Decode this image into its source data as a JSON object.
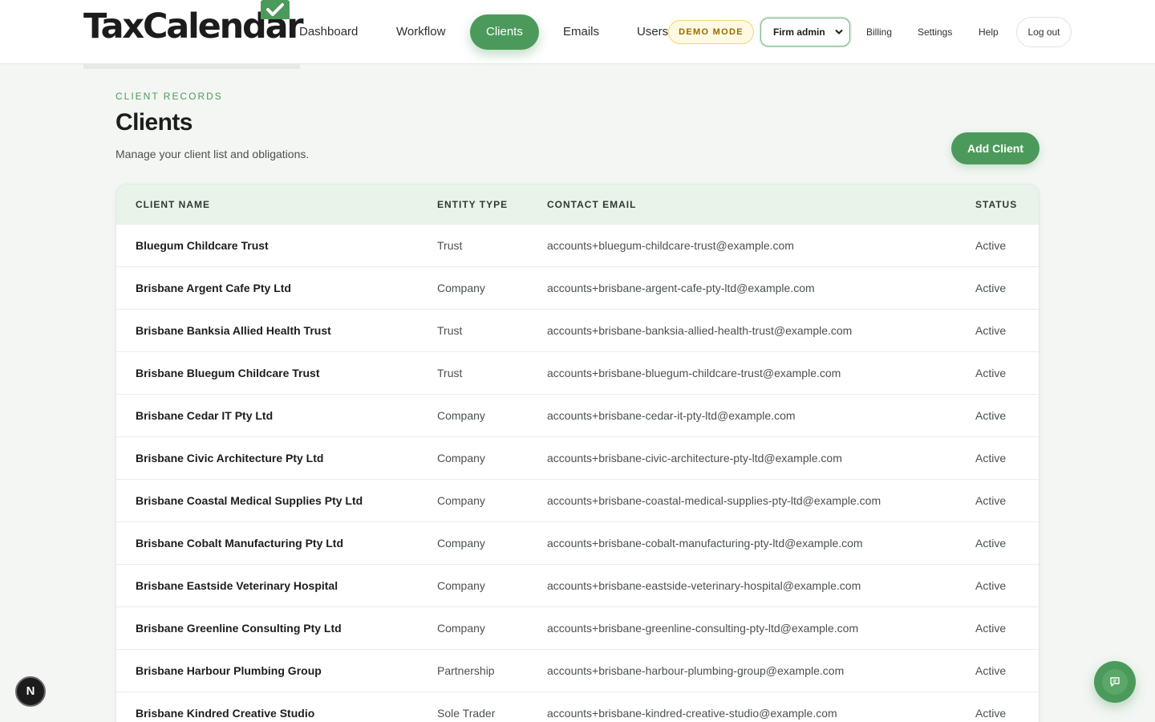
{
  "header": {
    "logo_text": "TaxCalendar",
    "nav": [
      "Dashboard",
      "Workflow",
      "Clients",
      "Emails",
      "Users"
    ],
    "active_nav": "Clients",
    "demo_badge": "DEMO MODE",
    "role": "Firm admin",
    "links": [
      "Billing",
      "Settings",
      "Help"
    ],
    "logout": "Log out",
    "accent_color": "#4c9a5b"
  },
  "page": {
    "eyebrow": "CLIENT RECORDS",
    "title": "Clients",
    "subtitle": "Manage your client list and obligations.",
    "add_button": "Add Client"
  },
  "table": {
    "columns": [
      "CLIENT NAME",
      "ENTITY TYPE",
      "CONTACT EMAIL",
      "STATUS"
    ],
    "rows": [
      {
        "name": "Bluegum Childcare Trust",
        "entity": "Trust",
        "email": "accounts+bluegum-childcare-trust@example.com",
        "status": "Active"
      },
      {
        "name": "Brisbane Argent Cafe Pty Ltd",
        "entity": "Company",
        "email": "accounts+brisbane-argent-cafe-pty-ltd@example.com",
        "status": "Active"
      },
      {
        "name": "Brisbane Banksia Allied Health Trust",
        "entity": "Trust",
        "email": "accounts+brisbane-banksia-allied-health-trust@example.com",
        "status": "Active"
      },
      {
        "name": "Brisbane Bluegum Childcare Trust",
        "entity": "Trust",
        "email": "accounts+brisbane-bluegum-childcare-trust@example.com",
        "status": "Active"
      },
      {
        "name": "Brisbane Cedar IT Pty Ltd",
        "entity": "Company",
        "email": "accounts+brisbane-cedar-it-pty-ltd@example.com",
        "status": "Active"
      },
      {
        "name": "Brisbane Civic Architecture Pty Ltd",
        "entity": "Company",
        "email": "accounts+brisbane-civic-architecture-pty-ltd@example.com",
        "status": "Active"
      },
      {
        "name": "Brisbane Coastal Medical Supplies Pty Ltd",
        "entity": "Company",
        "email": "accounts+brisbane-coastal-medical-supplies-pty-ltd@example.com",
        "status": "Active"
      },
      {
        "name": "Brisbane Cobalt Manufacturing Pty Ltd",
        "entity": "Company",
        "email": "accounts+brisbane-cobalt-manufacturing-pty-ltd@example.com",
        "status": "Active"
      },
      {
        "name": "Brisbane Eastside Veterinary Hospital",
        "entity": "Company",
        "email": "accounts+brisbane-eastside-veterinary-hospital@example.com",
        "status": "Active"
      },
      {
        "name": "Brisbane Greenline Consulting Pty Ltd",
        "entity": "Company",
        "email": "accounts+brisbane-greenline-consulting-pty-ltd@example.com",
        "status": "Active"
      },
      {
        "name": "Brisbane Harbour Plumbing Group",
        "entity": "Partnership",
        "email": "accounts+brisbane-harbour-plumbing-group@example.com",
        "status": "Active"
      },
      {
        "name": "Brisbane Kindred Creative Studio",
        "entity": "Sole Trader",
        "email": "accounts+brisbane-kindred-creative-studio@example.com",
        "status": "Active"
      }
    ]
  },
  "floating": {
    "dev_badge": "N",
    "chat_icon": "chat-icon"
  }
}
